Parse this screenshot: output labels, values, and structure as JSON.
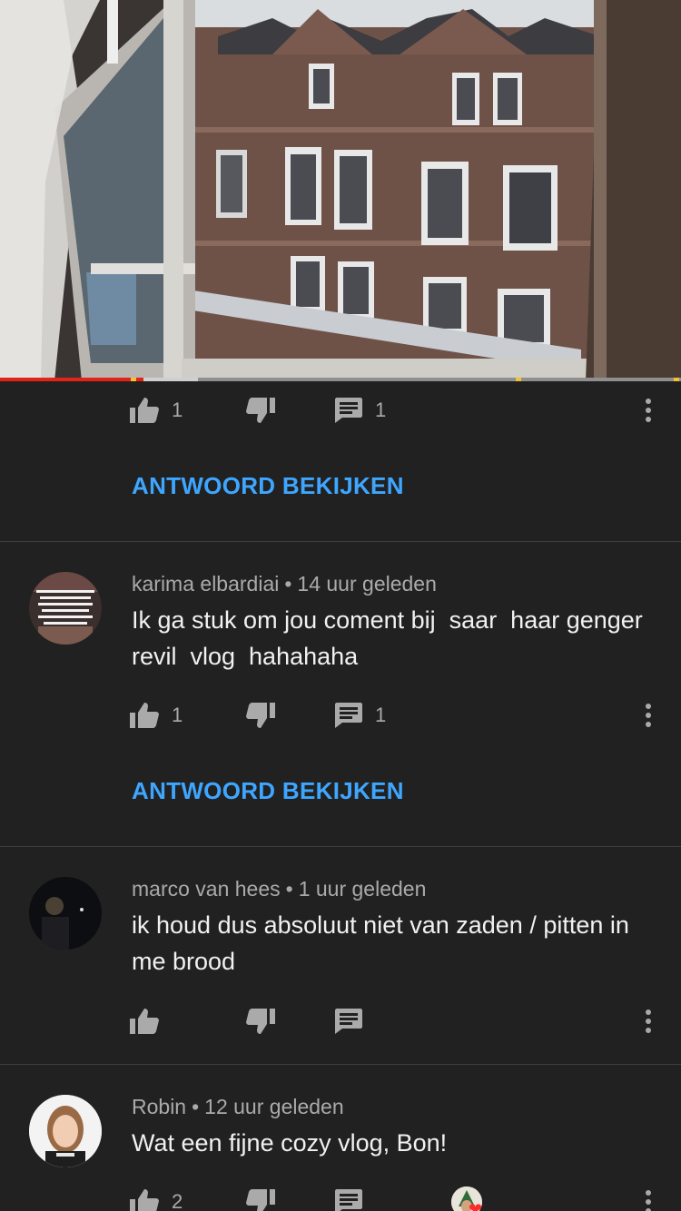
{
  "video": {
    "progress_played_pct": 21,
    "buffered_pct": 29
  },
  "top_comment_actions": {
    "likes": "1",
    "replies": "1",
    "view_replies_label": "ANTWOORD BEKIJKEN"
  },
  "comments": [
    {
      "author": "karima elbardiai",
      "time": "14 uur geleden",
      "text": "Ik ga stuk om jou coment bij  saar  haar genger revil  vlog  hahahaha",
      "likes": "1",
      "replies": "1",
      "view_replies_label": "ANTWOORD BEKIJKEN",
      "avatar_text": "Hou niet om het vertellen, dat is weg. Maak je niet druk om de toekomst, die komt nog. Leef in en geniet van het heden."
    },
    {
      "author": "marco van hees",
      "time": "1 uur geleden",
      "text": "ik houd dus absoluut niet van zaden / pitten in me brood"
    },
    {
      "author": "Robin",
      "time": "12 uur geleden",
      "text": "Wat een fijne cozy vlog, Bon!",
      "likes": "2",
      "creator_heart": true
    }
  ],
  "icons": {
    "like": "thumbs-up-icon",
    "dislike": "thumbs-down-icon",
    "reply": "comment-icon",
    "more": "more-vertical-icon"
  },
  "colors": {
    "background": "#212121",
    "link": "#3ea6ff",
    "progress": "#e62117",
    "secondary_text": "#aaaaaa"
  }
}
